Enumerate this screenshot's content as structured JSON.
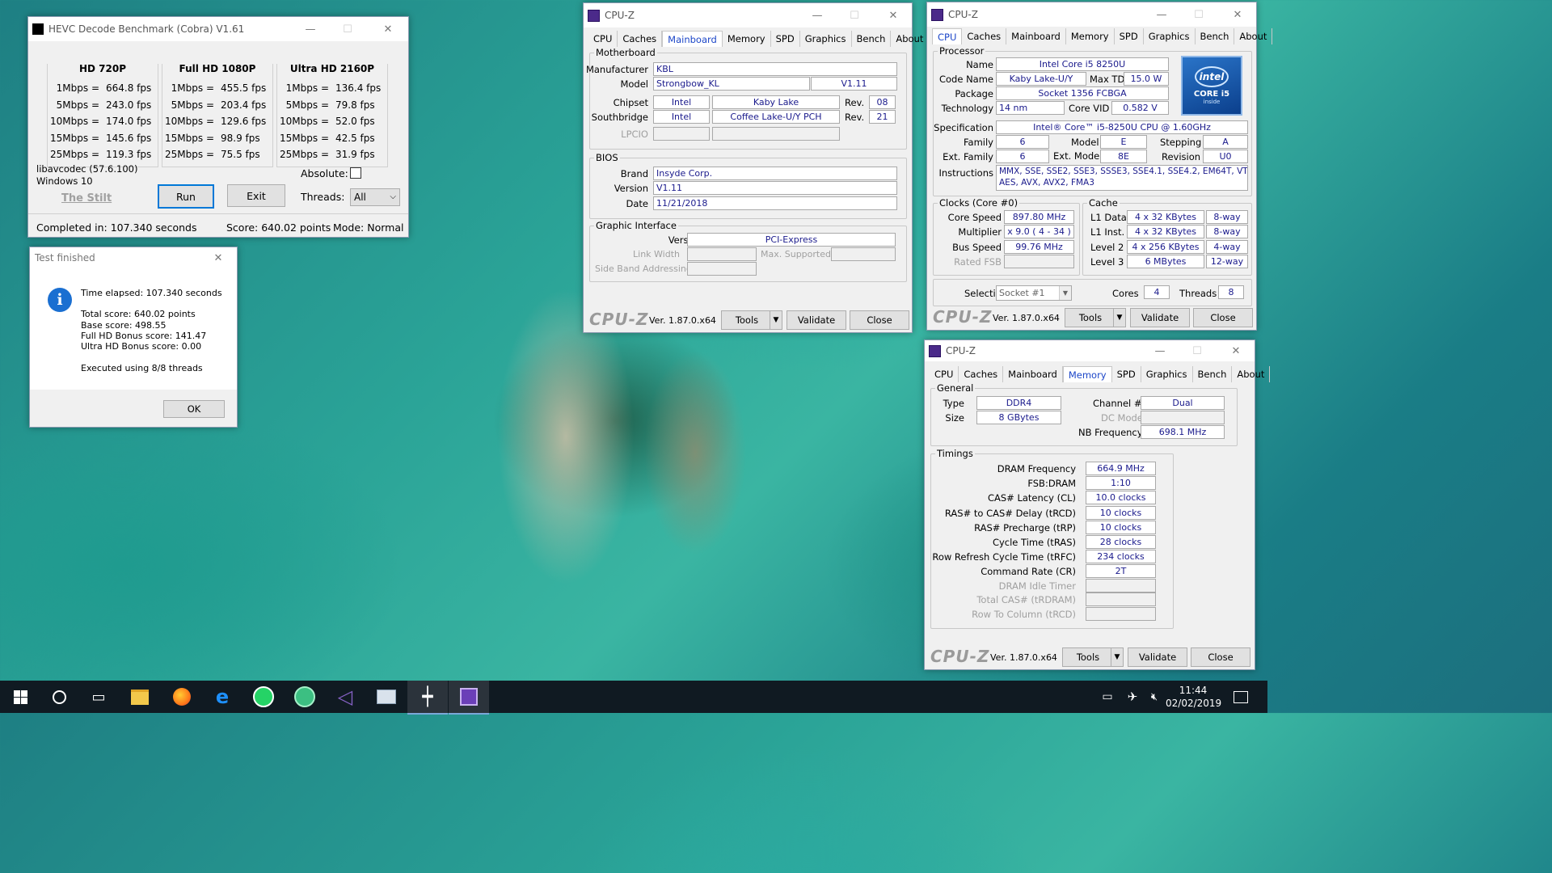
{
  "hevc": {
    "title": "HEVC Decode Benchmark (Cobra) V1.61",
    "columns": [
      {
        "header": "HD 720P",
        "rows": [
          [
            "1Mbps =",
            "664.8 fps"
          ],
          [
            "5Mbps =",
            "243.0 fps"
          ],
          [
            "10Mbps =",
            "174.0 fps"
          ],
          [
            "15Mbps =",
            "145.6 fps"
          ],
          [
            "25Mbps =",
            "119.3 fps"
          ]
        ]
      },
      {
        "header": "Full HD 1080P",
        "rows": [
          [
            "1Mbps =",
            "455.5 fps"
          ],
          [
            "5Mbps =",
            "203.4 fps"
          ],
          [
            "10Mbps =",
            "129.6 fps"
          ],
          [
            "15Mbps =",
            "98.9 fps"
          ],
          [
            "25Mbps =",
            "75.5 fps"
          ]
        ]
      },
      {
        "header": "Ultra HD 2160P",
        "rows": [
          [
            "1Mbps =",
            "136.4 fps"
          ],
          [
            "5Mbps =",
            "79.8 fps"
          ],
          [
            "10Mbps =",
            "52.0 fps"
          ],
          [
            "15Mbps =",
            "42.5 fps"
          ],
          [
            "25Mbps =",
            "31.9 fps"
          ]
        ]
      }
    ],
    "codec": "libavcodec (57.6.100)",
    "os": "Windows 10",
    "stilt": "The Stilt",
    "run": "Run",
    "exit": "Exit",
    "absolute": "Absolute:",
    "threads_label": "Threads:",
    "threads_value": "All",
    "completed": "Completed in: 107.340 seconds",
    "score": "Score: 640.02 points",
    "mode": "Mode: Normal"
  },
  "dialog": {
    "title": "Test finished",
    "time": "Time elapsed:  107.340 seconds",
    "total": "Total score:  640.02 points",
    "base": "Base score: 498.55",
    "fullhd": "Full HD Bonus score: 141.47",
    "uhd": "Ultra HD Bonus score: 0.00",
    "threads": "Executed using 8/8 threads",
    "ok": "OK"
  },
  "cpuz_common": {
    "title": "CPU-Z",
    "tabs": [
      "CPU",
      "Caches",
      "Mainboard",
      "Memory",
      "SPD",
      "Graphics",
      "Bench",
      "About"
    ],
    "brand": "CPU-Z",
    "version": "Ver. 1.87.0.x64",
    "tools": "Tools",
    "validate": "Validate",
    "close": "Close"
  },
  "mainboard": {
    "motherboard": "Motherboard",
    "manufacturer_l": "Manufacturer",
    "manufacturer": "KBL",
    "model_l": "Model",
    "model": "Strongbow_KL",
    "model_rev": "V1.11",
    "chipset_l": "Chipset",
    "chipset_vendor": "Intel",
    "chipset": "Kaby Lake",
    "rev_l": "Rev.",
    "chipset_rev": "08",
    "south_l": "Southbridge",
    "south_vendor": "Intel",
    "south": "Coffee Lake-U/Y PCH",
    "south_rev": "21",
    "lpcio_l": "LPCIO",
    "bios": "BIOS",
    "brand_l": "Brand",
    "brand": "Insyde Corp.",
    "version_l": "Version",
    "version": "V1.11",
    "date_l": "Date",
    "date": "11/21/2018",
    "gi": "Graphic Interface",
    "gi_version_l": "Version",
    "gi_version": "PCI-Express",
    "link_l": "Link Width",
    "max_l": "Max. Supported",
    "sba_l": "Side Band Addressing"
  },
  "cpu": {
    "processor": "Processor",
    "name_l": "Name",
    "name": "Intel Core i5 8250U",
    "code_l": "Code Name",
    "code": "Kaby Lake-U/Y",
    "tdp_l": "Max TDP",
    "tdp": "15.0 W",
    "package_l": "Package",
    "package": "Socket 1356 FCBGA",
    "tech_l": "Technology",
    "tech": "14 nm",
    "vid_l": "Core VID",
    "vid": "0.582 V",
    "spec_l": "Specification",
    "spec": "Intel® Core™ i5-8250U CPU @ 1.60GHz",
    "family_l": "Family",
    "family": "6",
    "model_l": "Model",
    "model": "E",
    "stepping_l": "Stepping",
    "stepping": "A",
    "extfam_l": "Ext. Family",
    "extfam": "6",
    "extmodel_l": "Ext. Model",
    "extmodel": "8E",
    "revision_l": "Revision",
    "revision": "U0",
    "instr_l": "Instructions",
    "instr1": "MMX, SSE, SSE2, SSE3, SSSE3, SSE4.1, SSE4.2, EM64T, VT-x,",
    "instr2": "AES, AVX, AVX2, FMA3",
    "logo_top": "intel",
    "logo_mid": "CORE i5",
    "logo_bot": "inside",
    "clocks": "Clocks (Core #0)",
    "speed_l": "Core Speed",
    "speed": "897.80 MHz",
    "mult_l": "Multiplier",
    "mult": "x 9.0 ( 4 - 34 )",
    "bus_l": "Bus Speed",
    "bus": "99.76 MHz",
    "fsb_l": "Rated FSB",
    "cache": "Cache",
    "l1d_l": "L1 Data",
    "l1d": "4 x 32 KBytes",
    "l1d_w": "8-way",
    "l1i_l": "L1 Inst.",
    "l1i": "4 x 32 KBytes",
    "l1i_w": "8-way",
    "l2_l": "Level 2",
    "l2": "4 x 256 KBytes",
    "l2_w": "4-way",
    "l3_l": "Level 3",
    "l3": "6 MBytes",
    "l3_w": "12-way",
    "sel_l": "Selection",
    "sel": "Socket #1",
    "cores_l": "Cores",
    "cores": "4",
    "threads_l": "Threads",
    "threads": "8"
  },
  "memory": {
    "general": "General",
    "type_l": "Type",
    "type": "DDR4",
    "chan_l": "Channel #",
    "chan": "Dual",
    "size_l": "Size",
    "size": "8 GBytes",
    "dc_l": "DC Mode",
    "nb_l": "NB Frequency",
    "nb": "698.1 MHz",
    "timings": "Timings",
    "rows": [
      [
        "DRAM Frequency",
        "664.9 MHz"
      ],
      [
        "FSB:DRAM",
        "1:10"
      ],
      [
        "CAS# Latency (CL)",
        "10.0 clocks"
      ],
      [
        "RAS# to CAS# Delay (tRCD)",
        "10 clocks"
      ],
      [
        "RAS# Precharge (tRP)",
        "10 clocks"
      ],
      [
        "Cycle Time (tRAS)",
        "28 clocks"
      ],
      [
        "Row Refresh Cycle Time (tRFC)",
        "234 clocks"
      ],
      [
        "Command Rate (CR)",
        "2T"
      ]
    ],
    "idle_l": "DRAM Idle Timer",
    "tcas_l": "Total CAS# (tRDRAM)",
    "rtc_l": "Row To Column (tRCD)"
  },
  "taskbar": {
    "time": "11:44",
    "date": "02/02/2019"
  }
}
